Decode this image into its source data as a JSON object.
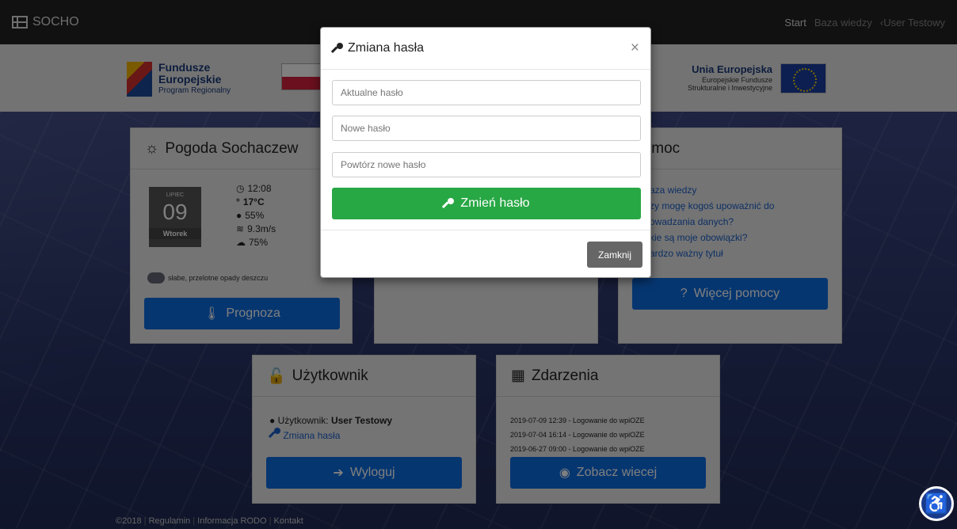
{
  "navbar": {
    "brand": "SOCHO",
    "links": [
      "Start",
      "Baza wiedzy"
    ],
    "user": "User Testowy"
  },
  "logos": {
    "fe_line1": "Fundusze",
    "fe_line2": "Europejskie",
    "fe_line3": "Program Regionalny",
    "eu_line1": "Unia Europejska",
    "eu_line2": "Europejskie Fundusze",
    "eu_line3": "Strukturalne i Inwestycyjne"
  },
  "weather": {
    "title": "Pogoda Sochaczew",
    "month": "LIPIEC",
    "day": "09",
    "weekday": "Wtorek",
    "time": "12:08",
    "temp": "17°C",
    "humidity": "55%",
    "wind": "9.3m/s",
    "clouds": "75%",
    "description": "słabe, przelotne opady deszczu",
    "button": "Prognoza"
  },
  "help": {
    "title": "Pomoc",
    "links": [
      "aza wiedzy",
      "zy mogę kogoś upoważnić do",
      "owadzania danych?",
      "kie są moje obowiązki?",
      "ardzo ważny tytuł"
    ],
    "button": "Więcej pomocy"
  },
  "user_panel": {
    "title": "Użytkownik",
    "label": "Użytkownik:",
    "name": "User Testowy",
    "change_password": "Zmiana hasła",
    "logout": "Wyloguj"
  },
  "events": {
    "title": "Zdarzenia",
    "items": [
      "2019-07-09 12:39 - Logowanie do wpiOZE",
      "2019-07-04 16:14 - Logowanie do wpiOZE",
      "2019-06-27 09:00 - Logowanie do wpiOZE"
    ],
    "button": "Zobacz wiecej"
  },
  "footer": {
    "copyright": "©2018",
    "links": [
      "Regulamin",
      "Informacja RODO",
      "Kontakt"
    ]
  },
  "modal": {
    "title": "Zmiana hasła",
    "current_placeholder": "Aktualne hasło",
    "new_placeholder": "Nowe hasło",
    "repeat_placeholder": "Powtórz nowe hasło",
    "submit": "Zmień hasło",
    "close": "Zamknij"
  }
}
